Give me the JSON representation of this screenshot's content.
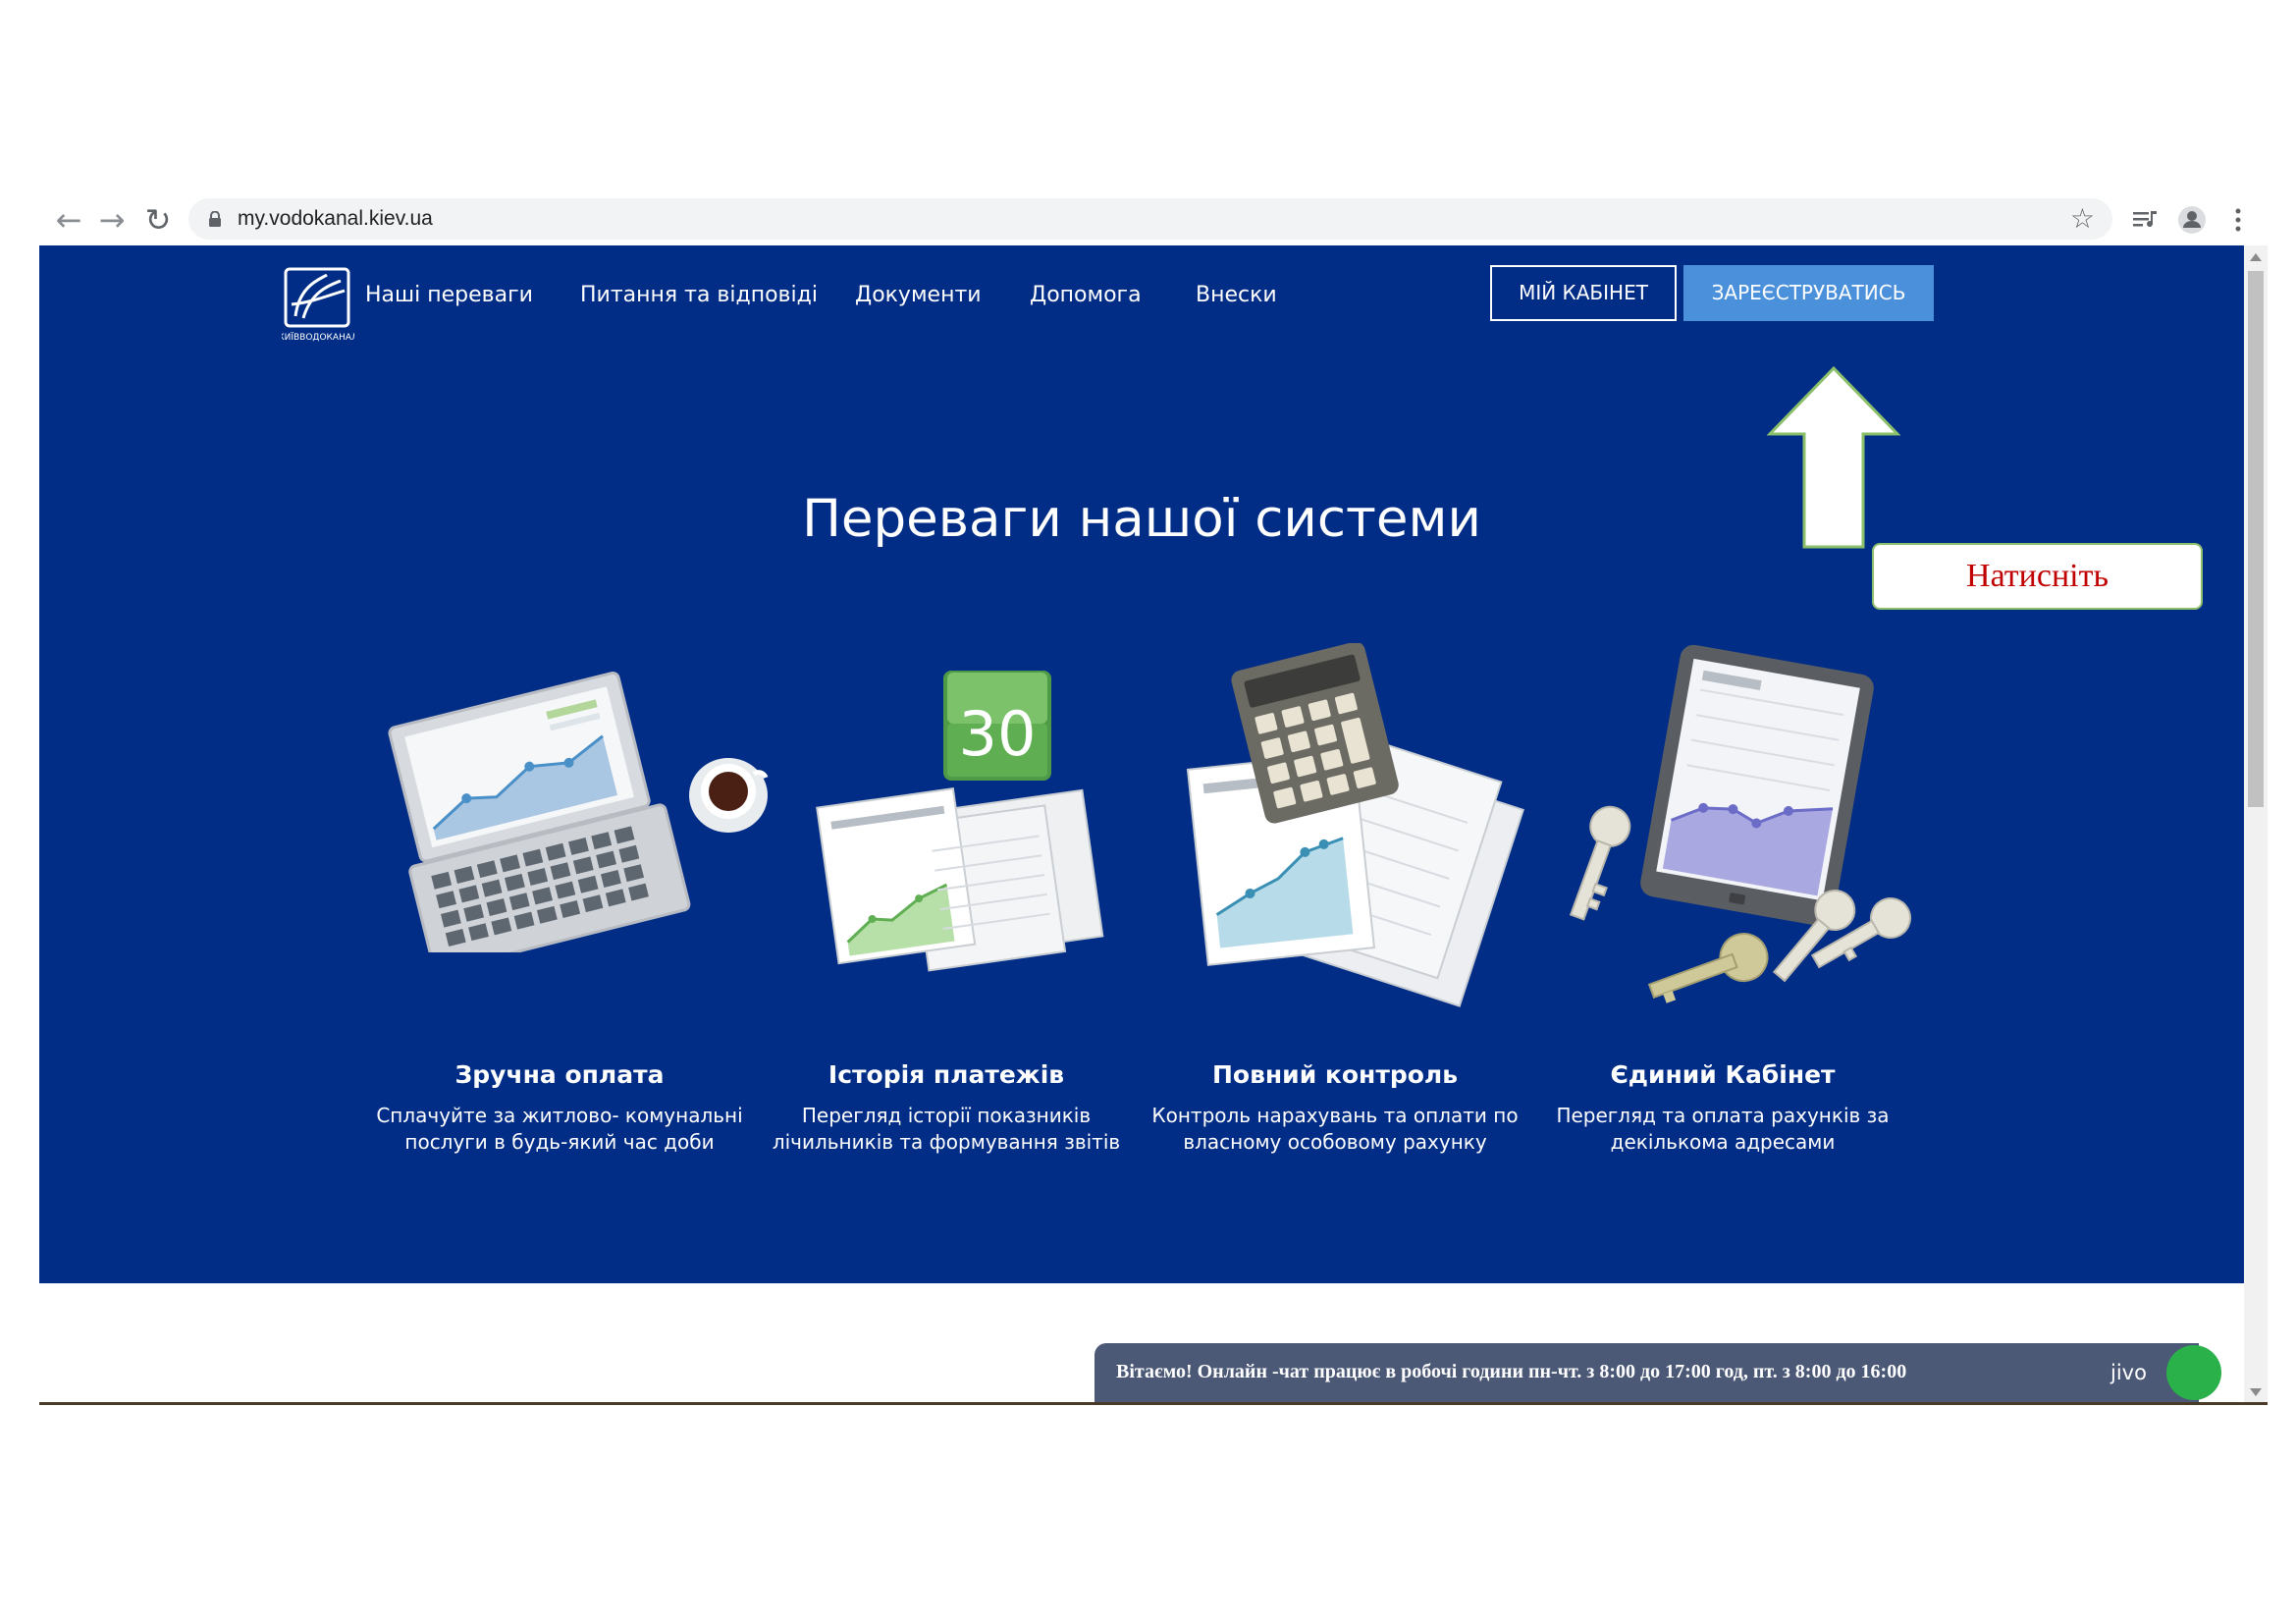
{
  "browser": {
    "url": "my.vodokanal.kiev.ua",
    "back_icon": "←",
    "forward_icon": "→",
    "reload_icon": "↻",
    "star_icon": "☆"
  },
  "header": {
    "logo_text": "КИЇВВОДОКАНАЛ",
    "nav": [
      "Наші переваги",
      "Питання та відповіді",
      "Документи",
      "Допомога",
      "Внески"
    ],
    "cabinet_button": "МІЙ КАБІНЕТ",
    "register_button": "ЗАРЕЄСТРУВАТИСЬ"
  },
  "hero": {
    "title": "Переваги нашої системи"
  },
  "features": [
    {
      "title": "Зручна оплата",
      "text": "Сплачуйте за житлово- комунальні послуги в будь-який час доби"
    },
    {
      "title": "Історія платежів",
      "text": "Перегляд історії показників лічильників та формування звітів",
      "calendar_number": "30"
    },
    {
      "title": "Повний контроль",
      "text": "Контроль нарахувань та оплати по власному особовому рахунку"
    },
    {
      "title": "Єдиний Кабінет",
      "text": "Перегляд та оплата рахунків за декількома адресами"
    }
  ],
  "chat": {
    "text": "Вітаємо! Онлайн -чат працює в робочі години пн-чт. з 8:00 до 17:00 год, пт. з 8:00 до 16:00",
    "logo": "jivo"
  },
  "annotation": {
    "label": "Натисніть"
  },
  "colors": {
    "page_bg": "#012d87",
    "register_button": "#4a90da",
    "annotation_text": "#c00000",
    "chat_bg": "#4b5876"
  }
}
